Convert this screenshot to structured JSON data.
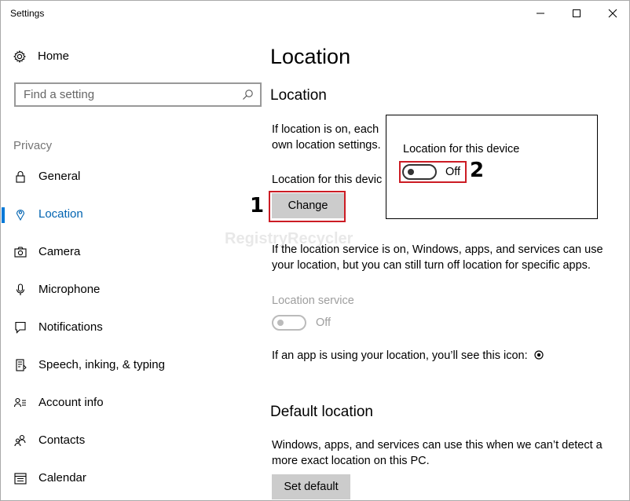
{
  "window": {
    "title": "Settings",
    "controls": {
      "minimize": "minimize-icon",
      "maximize": "maximize-icon",
      "close": "close-icon"
    }
  },
  "sidebar": {
    "home_label": "Home",
    "search_placeholder": "Find a setting",
    "section_label": "Privacy",
    "items": [
      {
        "label": "General",
        "icon": "lock-icon"
      },
      {
        "label": "Location",
        "icon": "location-pin-icon",
        "active": true
      },
      {
        "label": "Camera",
        "icon": "camera-icon"
      },
      {
        "label": "Microphone",
        "icon": "microphone-icon"
      },
      {
        "label": "Notifications",
        "icon": "notifications-icon"
      },
      {
        "label": "Speech, inking, & typing",
        "icon": "speech-icon"
      },
      {
        "label": "Account info",
        "icon": "account-info-icon"
      },
      {
        "label": "Contacts",
        "icon": "contacts-icon"
      },
      {
        "label": "Calendar",
        "icon": "calendar-icon"
      }
    ]
  },
  "content": {
    "page_title": "Location",
    "section1": {
      "heading": "Location",
      "desc_line1": "If location is on, each",
      "desc_line2": "own location settings.",
      "device_label": "Location for this devic",
      "change_button": "Change",
      "service_desc_line1": "If the location service is on, Windows, apps, and services can use",
      "service_desc_line2": "your location, but you can still turn off location for specific apps.",
      "service_label": "Location service",
      "service_state": "Off",
      "icon_note": "If an app is using your location, you’ll see this icon:"
    },
    "section2": {
      "heading": "Default location",
      "desc_line1": "Windows, apps, and services can use this when we can’t detect a",
      "desc_line2": "more exact location on this PC.",
      "set_default_button": "Set default"
    }
  },
  "popup": {
    "label": "Location for this device",
    "state": "Off"
  },
  "callouts": {
    "one": "1",
    "two": "2"
  },
  "watermark": {
    "text": "RegistryRecycler"
  },
  "colors": {
    "accent": "#0078d7",
    "accent_text": "#0063b1",
    "highlight": "#cc1c24",
    "button": "#cccccc"
  }
}
